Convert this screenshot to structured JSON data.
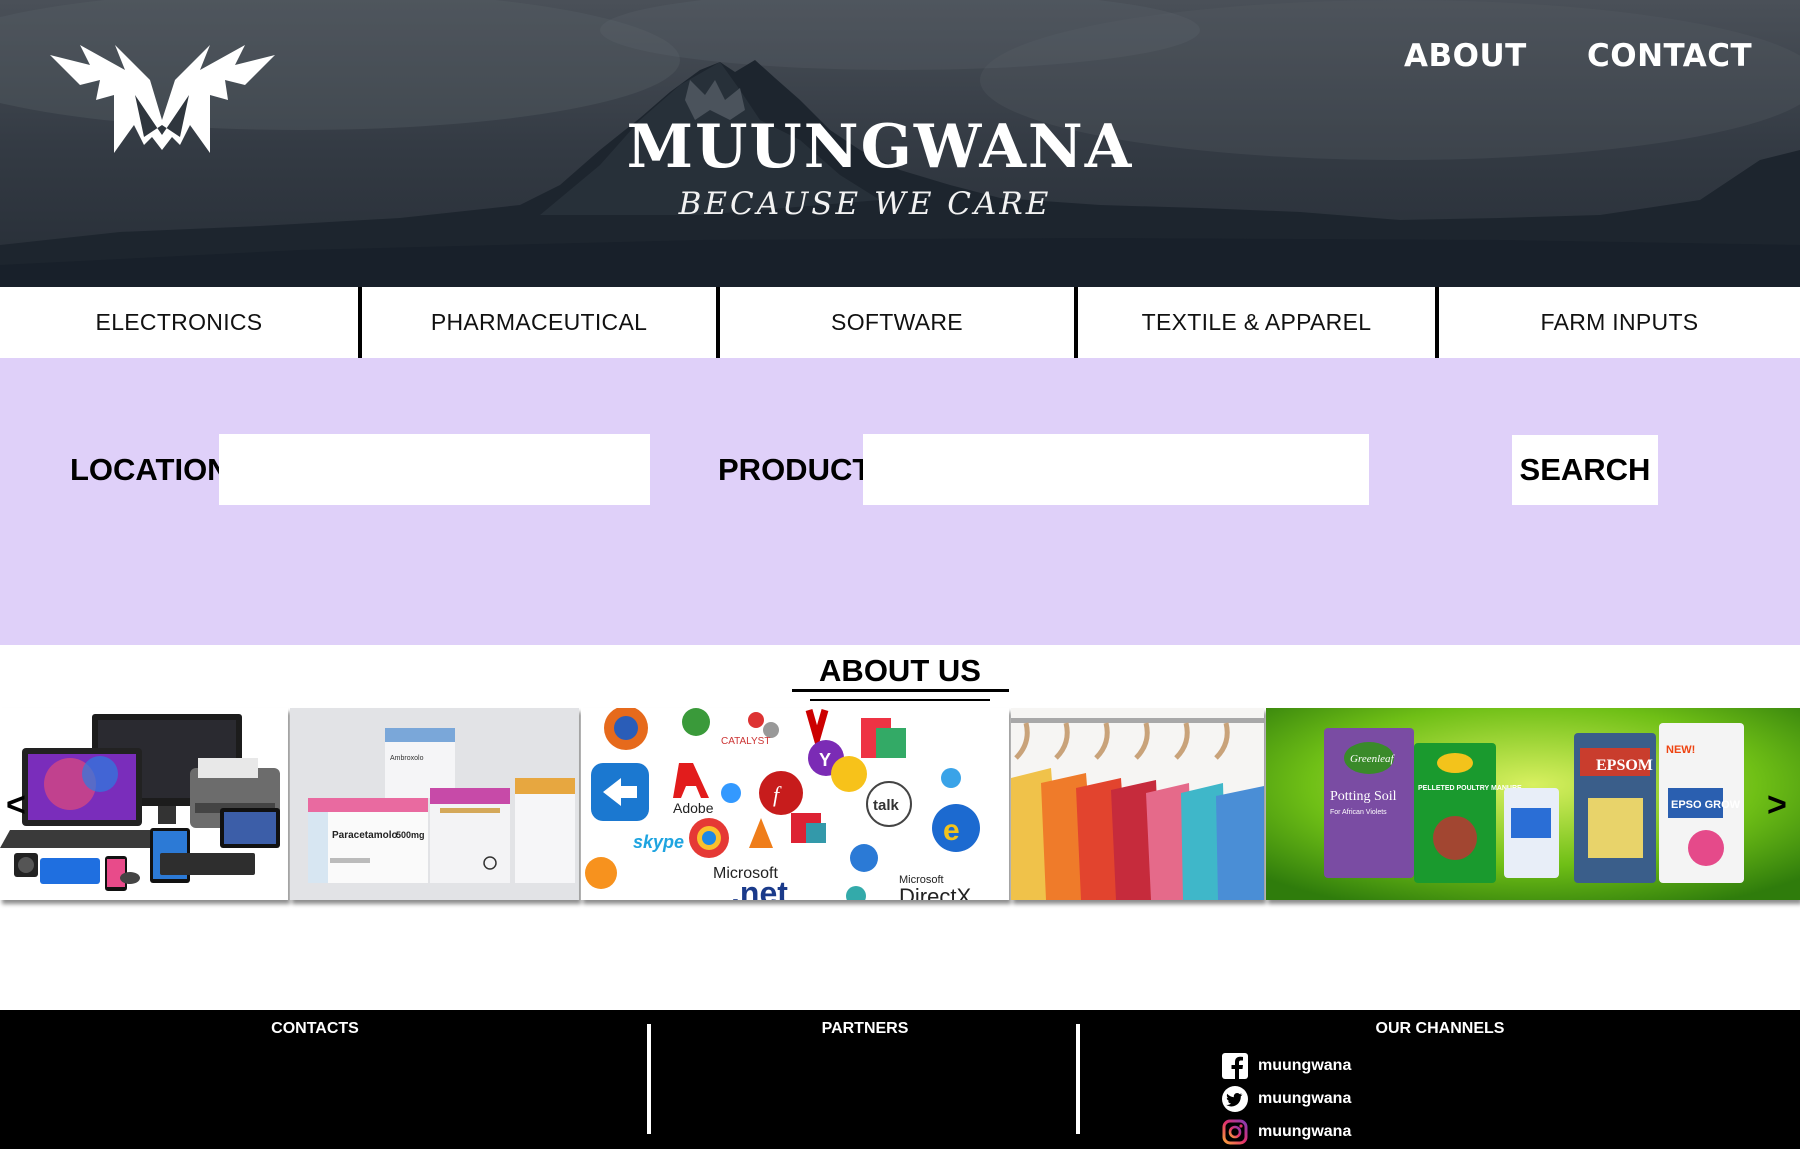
{
  "header": {
    "brand": "MUUNGWANA",
    "tagline": "BECAUSE WE CARE",
    "nav": {
      "about": "ABOUT",
      "contact": "CONTACT"
    },
    "logo_icon": "winged-m-logo-icon"
  },
  "categories": [
    {
      "label": "ELECTRONICS"
    },
    {
      "label": "PHARMACEUTICAL"
    },
    {
      "label": "SOFTWARE"
    },
    {
      "label": "TEXTILE & APPAREL"
    },
    {
      "label": "FARM INPUTS"
    }
  ],
  "search": {
    "location_label": "LOCATION",
    "location_value": "",
    "product_label": "PRODUCT",
    "product_value": "",
    "button": "SEARCH",
    "band_color": "#dfd0f9"
  },
  "about": {
    "title": "ABOUT US"
  },
  "carousel": {
    "prev": "<",
    "next": ">",
    "slides": [
      {
        "name": "electronics-image",
        "labels": []
      },
      {
        "name": "pharmaceutical-image",
        "labels": [
          "Paracetamolo",
          "500mg",
          "Ambroxolo"
        ]
      },
      {
        "name": "software-image",
        "labels": [
          "Adobe",
          "skype",
          "talk",
          "Microsoft",
          ".net",
          "Microsoft",
          "DirectX",
          "CATALYST"
        ]
      },
      {
        "name": "textile-image",
        "labels": []
      },
      {
        "name": "farm-inputs-image",
        "labels": [
          "Greenleaf",
          "Potting Soil",
          "For African Violets",
          "PELLETED POULTRY MANURE",
          "EPSOM",
          "EPSO GROW",
          "NEW!"
        ]
      }
    ]
  },
  "footer": {
    "contacts": "CONTACTS",
    "partners": "PARTNERS",
    "channels": "OUR CHANNELS",
    "channel_items": [
      {
        "icon": "facebook-icon",
        "handle": "muungwana"
      },
      {
        "icon": "twitter-icon",
        "handle": "muungwana"
      },
      {
        "icon": "instagram-icon",
        "handle": "muungwana"
      }
    ]
  }
}
